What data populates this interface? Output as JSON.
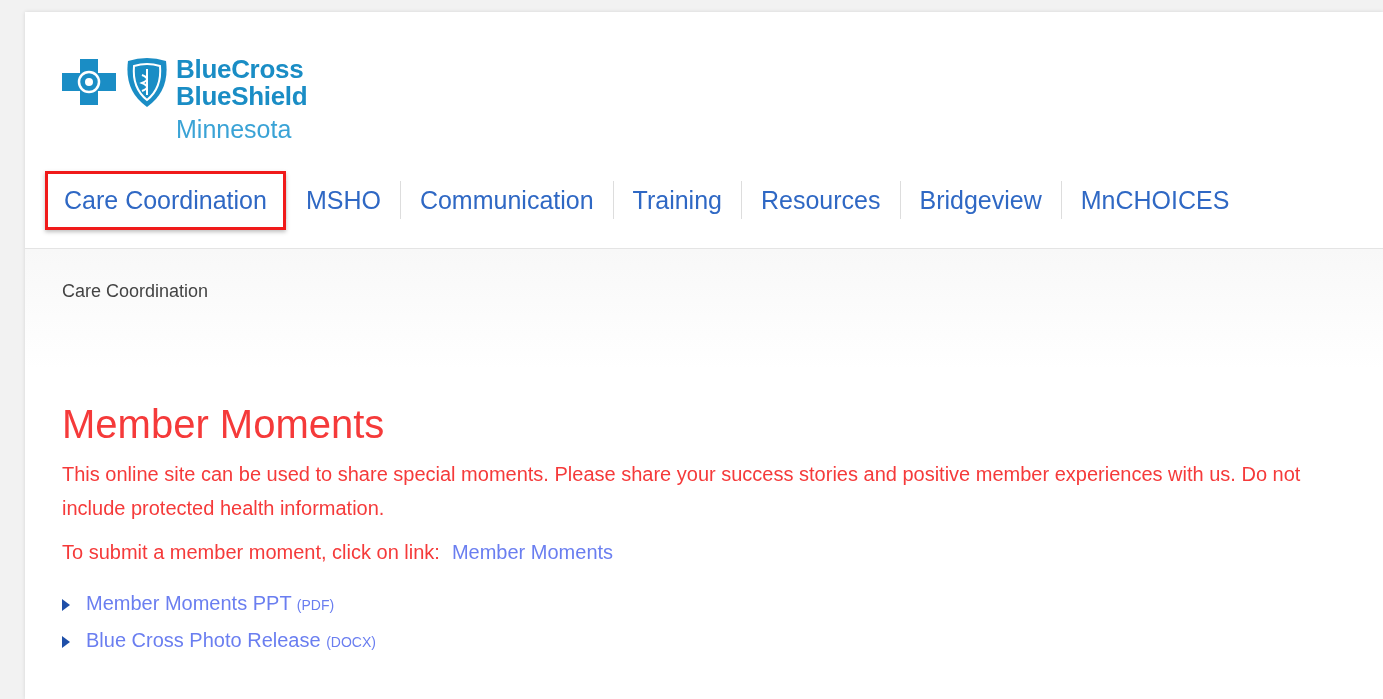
{
  "logo": {
    "line_1": "BlueCross",
    "line_2": "BlueShield",
    "region": "Minnesota"
  },
  "nav": [
    {
      "label": "Care Coordination",
      "highlighted": true
    },
    {
      "label": "MSHO",
      "highlighted": false
    },
    {
      "label": "Communication",
      "highlighted": false
    },
    {
      "label": "Training",
      "highlighted": false
    },
    {
      "label": "Resources",
      "highlighted": false
    },
    {
      "label": "Bridgeview",
      "highlighted": false
    },
    {
      "label": "MnCHOICES",
      "highlighted": false
    }
  ],
  "breadcrumb": "Care Coordination",
  "title": "Member Moments",
  "intro": "This online site can be used to share special moments.  Please share your success stories and positive member experiences with us. Do not include protected health information.",
  "submit": {
    "text": "To submit a member moment, click on link:",
    "link": "Member Moments"
  },
  "documents": [
    {
      "label": "Member Moments PPT",
      "type": "(PDF)"
    },
    {
      "label": "Blue Cross Photo Release",
      "type": "(DOCX)"
    }
  ]
}
